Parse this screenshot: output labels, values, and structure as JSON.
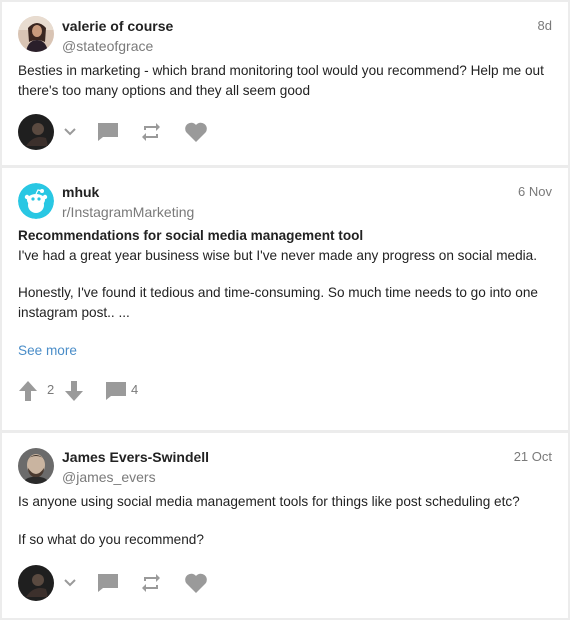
{
  "posts": [
    {
      "author": "valerie of course",
      "handle": "@stateofgrace",
      "time": "8d",
      "text": "Besties in marketing - which brand monitoring tool would you recommend? Help me out there's too many options and they all seem good",
      "avatar_icon": "user-photo-avatar"
    },
    {
      "author": "mhuk",
      "handle": "r/InstagramMarketing",
      "time": "6 Nov",
      "title": "Recommendations for social media management tool",
      "paragraph1": "I've had a great year business wise but I've never made any progress on social media.",
      "paragraph2_line1": "Honestly, I've found it tedious and time-consuming. So much time needs to go into one",
      "paragraph2_line2": "instagram post.. ...",
      "see_more": "See more",
      "upvotes": "2",
      "comments": "4",
      "avatar_icon": "reddit-snoo-avatar"
    },
    {
      "author": "James Evers-Swindell",
      "handle": "@james_evers",
      "time": "21 Oct",
      "line1": "Is anyone using social media management tools for things like post scheduling etc?",
      "line2": "If so what do you recommend?",
      "avatar_icon": "user-photo-avatar"
    }
  ],
  "colors": {
    "background": "#ececec",
    "card": "#ffffff",
    "link": "#4a8dc8",
    "icon": "#9a9a9a",
    "snoo_bg": "#29c7e3"
  }
}
